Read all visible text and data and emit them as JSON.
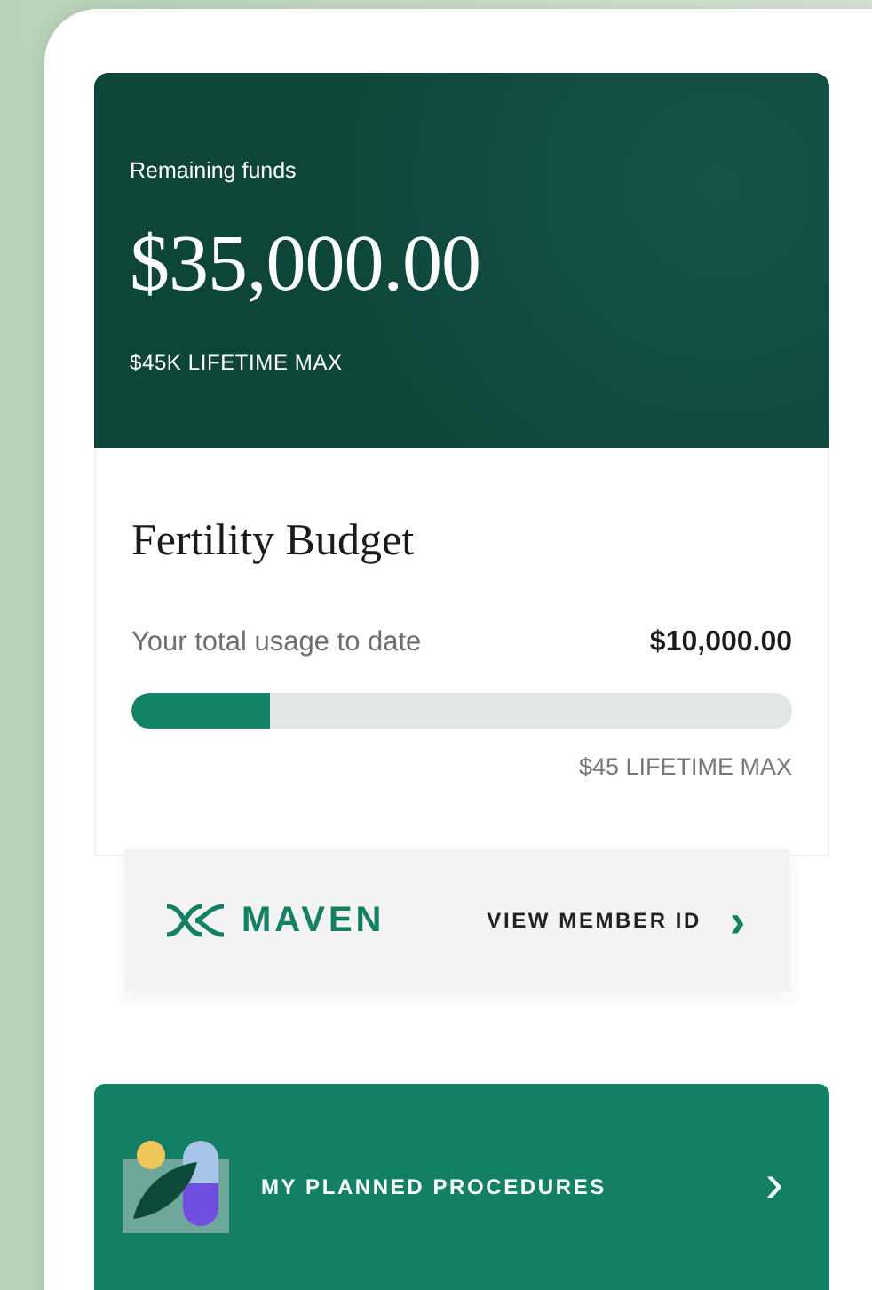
{
  "funds": {
    "label": "Remaining funds",
    "amount": "$35,000.00",
    "max": "$45K LIFETIME MAX"
  },
  "budget": {
    "title": "Fertility Budget",
    "usage_label": "Your total usage to date",
    "usage_amount": "$10,000.00",
    "level": 0.21,
    "max": "$45 LIFETIME MAX"
  },
  "member": {
    "brand": "MAVEN",
    "link": "VIEW MEMBER ID",
    "chevron": "›"
  },
  "procedures": {
    "label": "MY PLANNED PROCEDURES",
    "chevron": "›"
  }
}
